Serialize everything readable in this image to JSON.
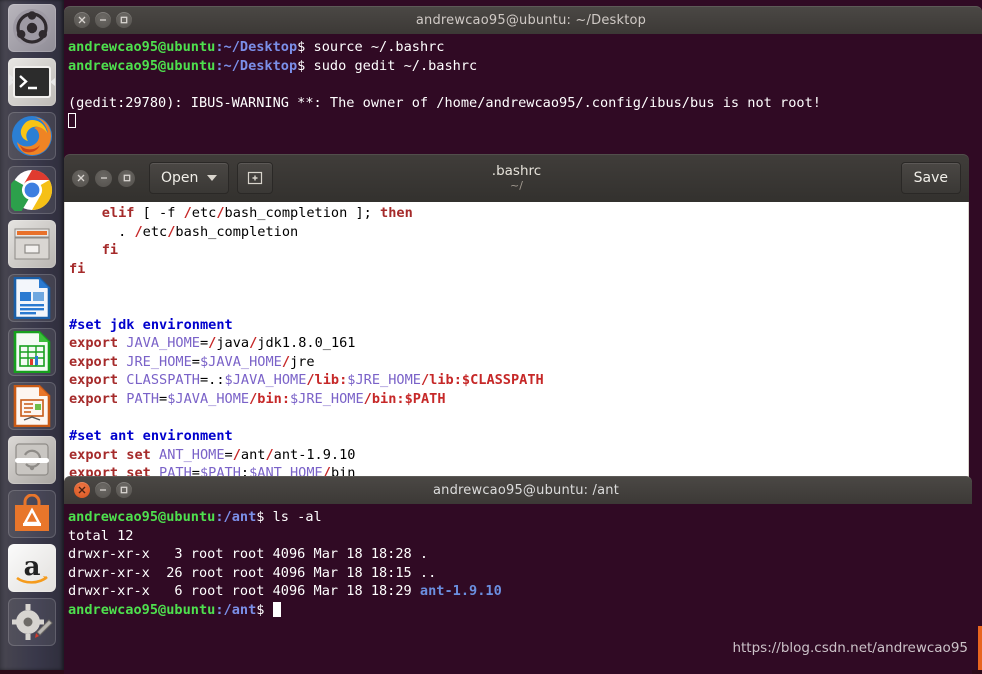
{
  "launcher": {
    "items": [
      {
        "name": "ubuntu-dash-icon",
        "label": "Ubuntu Dash"
      },
      {
        "name": "terminal-icon",
        "label": "Terminal"
      },
      {
        "name": "firefox-icon",
        "label": "Firefox"
      },
      {
        "name": "chrome-icon",
        "label": "Google Chrome"
      },
      {
        "name": "files-icon",
        "label": "Files"
      },
      {
        "name": "libreoffice-writer-icon",
        "label": "LibreOffice Writer"
      },
      {
        "name": "libreoffice-calc-icon",
        "label": "LibreOffice Calc"
      },
      {
        "name": "libreoffice-impress-icon",
        "label": "LibreOffice Impress"
      },
      {
        "name": "software-updater-icon",
        "label": "Software Updater"
      },
      {
        "name": "ubuntu-software-icon",
        "label": "Ubuntu Software"
      },
      {
        "name": "amazon-icon",
        "label": "Amazon"
      },
      {
        "name": "system-settings-icon",
        "label": "System Settings"
      }
    ]
  },
  "terminal_top": {
    "title": "andrewcao95@ubuntu: ~/Desktop",
    "prompt_user": "andrewcao95@ubuntu",
    "prompt_path": ":~/Desktop",
    "prompt_sym": "$ ",
    "line1_cmd": "source ~/.bashrc",
    "line2_cmd": "sudo gedit ~/.bashrc",
    "warning": "(gedit:29780): IBUS-WARNING **: The owner of /home/andrewcao95/.config/ibus/bus is not root!",
    "buttons": {
      "close": "close-icon",
      "minimize": "minimize-icon",
      "maximize": "maximize-icon"
    }
  },
  "gedit": {
    "open_label": "Open",
    "new_tab_label": "New Tab",
    "save_label": "Save",
    "doc_title": ".bashrc",
    "doc_path": "~/",
    "lines": [
      {
        "indent": "    ",
        "segs": [
          {
            "t": "elif ",
            "c": "k-kw"
          },
          {
            "t": "[ -f ",
            "c": "k-pl"
          },
          {
            "t": "/",
            "c": "k-sl"
          },
          {
            "t": "etc",
            "c": "k-pl"
          },
          {
            "t": "/",
            "c": "k-sl"
          },
          {
            "t": "bash_completion ",
            "c": "k-pl"
          },
          {
            "t": "]; ",
            "c": "k-pl"
          },
          {
            "t": "then",
            "c": "k-kw"
          }
        ]
      },
      {
        "indent": "      ",
        "segs": [
          {
            "t": ". ",
            "c": "k-pl"
          },
          {
            "t": "/",
            "c": "k-sl"
          },
          {
            "t": "etc",
            "c": "k-pl"
          },
          {
            "t": "/",
            "c": "k-sl"
          },
          {
            "t": "bash_completion",
            "c": "k-pl"
          }
        ]
      },
      {
        "indent": "    ",
        "segs": [
          {
            "t": "fi",
            "c": "k-kw"
          }
        ]
      },
      {
        "indent": "",
        "segs": [
          {
            "t": "fi",
            "c": "k-kw"
          }
        ]
      },
      {
        "indent": "",
        "segs": []
      },
      {
        "indent": "",
        "segs": []
      },
      {
        "indent": "",
        "segs": [
          {
            "t": "#set jdk environment",
            "c": "k-cm"
          }
        ]
      },
      {
        "indent": "",
        "segs": [
          {
            "t": "export ",
            "c": "k-kw"
          },
          {
            "t": "JAVA_HOME",
            "c": "k-var"
          },
          {
            "t": "=",
            "c": "k-pl"
          },
          {
            "t": "/",
            "c": "k-sl"
          },
          {
            "t": "java",
            "c": "k-pl"
          },
          {
            "t": "/",
            "c": "k-sl"
          },
          {
            "t": "jdk1.8.0_161",
            "c": "k-pl"
          }
        ]
      },
      {
        "indent": "",
        "segs": [
          {
            "t": "export ",
            "c": "k-kw"
          },
          {
            "t": "JRE_HOME",
            "c": "k-var"
          },
          {
            "t": "=",
            "c": "k-pl"
          },
          {
            "t": "$JAVA_HOME",
            "c": "k-var"
          },
          {
            "t": "/",
            "c": "k-sl"
          },
          {
            "t": "jre",
            "c": "k-pl"
          }
        ]
      },
      {
        "indent": "",
        "segs": [
          {
            "t": "export ",
            "c": "k-kw"
          },
          {
            "t": "CLASSPATH",
            "c": "k-var"
          },
          {
            "t": "=.:",
            "c": "k-pl"
          },
          {
            "t": "$JAVA_HOME",
            "c": "k-var"
          },
          {
            "t": "/lib:",
            "c": "k-sl"
          },
          {
            "t": "$JRE_HOME",
            "c": "k-var"
          },
          {
            "t": "/lib:",
            "c": "k-sl"
          },
          {
            "t": "$CLASSPATH",
            "c": "k-sl"
          }
        ]
      },
      {
        "indent": "",
        "segs": [
          {
            "t": "export ",
            "c": "k-kw"
          },
          {
            "t": "PATH",
            "c": "k-var"
          },
          {
            "t": "=",
            "c": "k-pl"
          },
          {
            "t": "$JAVA_HOME",
            "c": "k-var"
          },
          {
            "t": "/bin:",
            "c": "k-sl"
          },
          {
            "t": "$JRE_HOME",
            "c": "k-var"
          },
          {
            "t": "/bin:",
            "c": "k-sl"
          },
          {
            "t": "$PATH",
            "c": "k-sl"
          }
        ]
      },
      {
        "indent": "",
        "segs": []
      },
      {
        "indent": "",
        "segs": [
          {
            "t": "#set ant environment",
            "c": "k-cm"
          }
        ]
      },
      {
        "indent": "",
        "segs": [
          {
            "t": "export set ",
            "c": "k-kw"
          },
          {
            "t": "ANT_HOME",
            "c": "k-var"
          },
          {
            "t": "=",
            "c": "k-pl"
          },
          {
            "t": "/",
            "c": "k-sl"
          },
          {
            "t": "ant",
            "c": "k-pl"
          },
          {
            "t": "/",
            "c": "k-sl"
          },
          {
            "t": "ant-1.9.10",
            "c": "k-pl"
          }
        ]
      },
      {
        "indent": "",
        "segs": [
          {
            "t": "export set ",
            "c": "k-kw"
          },
          {
            "t": "PATH",
            "c": "k-var"
          },
          {
            "t": "=",
            "c": "k-pl"
          },
          {
            "t": "$PATH",
            "c": "k-var"
          },
          {
            "t": ":",
            "c": "k-pl"
          },
          {
            "t": "$ANT_HOME",
            "c": "k-var"
          },
          {
            "t": "/",
            "c": "k-sl"
          },
          {
            "t": "bin",
            "c": "k-pl"
          }
        ]
      }
    ]
  },
  "terminal_bottom": {
    "title": "andrewcao95@ubuntu: /ant",
    "prompt_user": "andrewcao95@ubuntu",
    "prompt_path": ":/ant",
    "prompt_sym": "$ ",
    "cmd": "ls -al",
    "out_total": "total 12",
    "rows": [
      {
        "perm": "drwxr-xr-x",
        "links": "  3",
        "owner": "root",
        "group": "root",
        "size": "4096",
        "month": "Mar",
        "day": "18",
        "time": "18:28",
        "name": ".",
        "name_colored": false
      },
      {
        "perm": "drwxr-xr-x",
        "links": " 26",
        "owner": "root",
        "group": "root",
        "size": "4096",
        "month": "Mar",
        "day": "18",
        "time": "18:15",
        "name": "..",
        "name_colored": false
      },
      {
        "perm": "drwxr-xr-x",
        "links": "  6",
        "owner": "root",
        "group": "root",
        "size": "4096",
        "month": "Mar",
        "day": "18",
        "time": "18:29",
        "name": "ant-1.9.10",
        "name_colored": true
      }
    ]
  },
  "watermark": {
    "text": "https://blog.csdn.net/andrewcao95"
  },
  "colors": {
    "terminal_bg": "#300a24",
    "prompt_green": "#4ee04e",
    "prompt_blue": "#7b8fe8",
    "dir_blue": "#6b8fe0",
    "titlebar": "#3c3936",
    "close_active": "#e8651f",
    "editor_bg": "#ffffff",
    "comment_blue": "#0000cd",
    "keyword_red": "#a52a2a",
    "variable_purple": "#7a62c8"
  }
}
